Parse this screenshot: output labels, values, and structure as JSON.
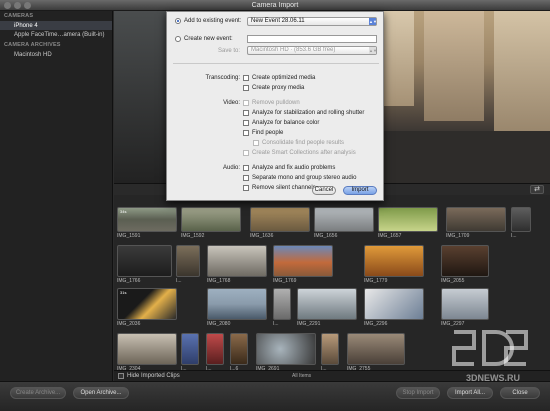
{
  "window": {
    "title": "Camera Import"
  },
  "sidebar": {
    "sections": [
      {
        "heading": "CAMERAS",
        "items": [
          {
            "label": "iPhone 4",
            "selected": true
          },
          {
            "label": "Apple FaceTime…amera (Built-in)",
            "selected": false
          }
        ]
      },
      {
        "heading": "CAMERA ARCHIVES",
        "items": [
          {
            "label": "Macintosh HD",
            "selected": false
          }
        ]
      }
    ]
  },
  "dialog": {
    "add_existing_label": "Add to existing event:",
    "existing_event_value": "New Event 28.06.11",
    "create_new_label": "Create new event:",
    "save_to_label": "Save to:",
    "save_to_value": "Macintosh HD · (853.6 GB free)",
    "transcoding_label": "Transcoding:",
    "transcoding": [
      {
        "label": "Create optimized media",
        "enabled": true
      },
      {
        "label": "Create proxy media",
        "enabled": true
      }
    ],
    "video_label": "Video:",
    "video": [
      {
        "label": "Remove pulldown",
        "enabled": false
      },
      {
        "label": "Analyze for stabilization and rolling shutter",
        "enabled": true
      },
      {
        "label": "Analyze for balance color",
        "enabled": true
      },
      {
        "label": "Find people",
        "enabled": true
      },
      {
        "label": "Consolidate find people results",
        "enabled": false,
        "indent": true
      },
      {
        "label": "Create Smart Collections after analysis",
        "enabled": false,
        "indent": true
      }
    ],
    "audio_label": "Audio:",
    "audio": [
      {
        "label": "Analyze and fix audio problems",
        "enabled": true
      },
      {
        "label": "Separate mono and group stereo audio",
        "enabled": true
      },
      {
        "label": "Remove silent channels",
        "enabled": true
      }
    ],
    "cancel_label": "Cancel",
    "import_label": "Import"
  },
  "clips": [
    {
      "name": "IMG_1591",
      "dur": "34s"
    },
    {
      "name": "IMG_1592",
      "dur": ""
    },
    {
      "name": "IMG_1636",
      "dur": ""
    },
    {
      "name": "IMG_1656",
      "dur": ""
    },
    {
      "name": "IMG_1657",
      "dur": ""
    },
    {
      "name": "IMG_1709",
      "dur": ""
    },
    {
      "name": "I...",
      "dur": ""
    },
    {
      "name": "IMG_1766",
      "dur": ""
    },
    {
      "name": "I...",
      "dur": ""
    },
    {
      "name": "IMG_1768",
      "dur": ""
    },
    {
      "name": "IMG_1769",
      "dur": ""
    },
    {
      "name": "IMG_1779",
      "dur": ""
    },
    {
      "name": "IMG_2055",
      "dur": ""
    },
    {
      "name": "IMG_2036",
      "dur": "31s"
    },
    {
      "name": "IMG_2080",
      "dur": ""
    },
    {
      "name": "I...",
      "dur": ""
    },
    {
      "name": "IMG_2291",
      "dur": ""
    },
    {
      "name": "IMG_2296",
      "dur": ""
    },
    {
      "name": "IMG_2297",
      "dur": ""
    },
    {
      "name": "IMG_2304",
      "dur": ""
    },
    {
      "name": "I...",
      "dur": ""
    },
    {
      "name": "I...",
      "dur": ""
    },
    {
      "name": "I...6",
      "dur": ""
    },
    {
      "name": "IMG_2691",
      "dur": ""
    },
    {
      "name": "I...",
      "dur": ""
    },
    {
      "name": "IMG_2755",
      "dur": ""
    }
  ],
  "grid_footer": {
    "hide_imported_label": "Hide Imported Clips",
    "items_label": "All Items"
  },
  "bottom": {
    "create_archive_label": "Create Archive...",
    "open_archive_label": "Open Archive...",
    "stop_import_label": "Stop Import",
    "import_all_label": "Import All...",
    "close_label": "Close"
  },
  "watermark": {
    "brand": "3DNews",
    "site": "3DNEWS.RU"
  },
  "colors": {
    "accent": "#5a82d8",
    "selection": "#3a3d44"
  }
}
